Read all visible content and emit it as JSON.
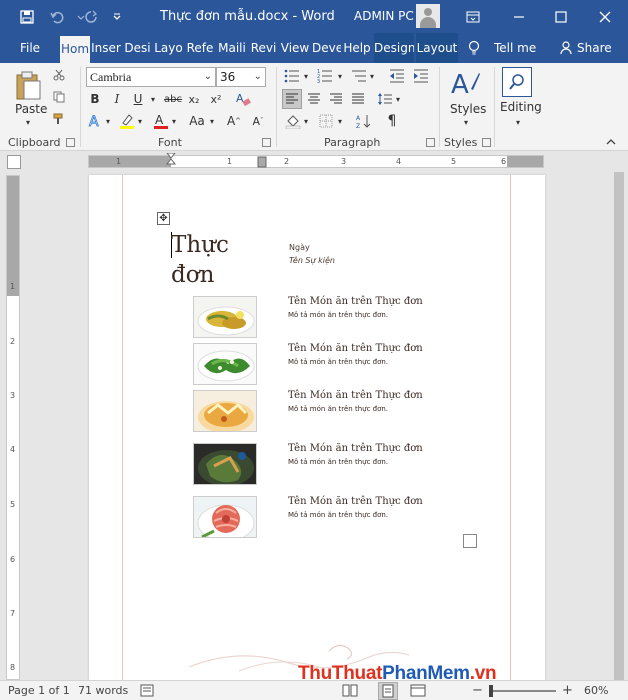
{
  "titlebar": {
    "document_title": "Thực đơn mẫu.docx  -  Word",
    "user_name": "ADMIN PC",
    "icons": [
      "save-icon",
      "undo-icon",
      "redo-icon",
      "customize-chevron-icon"
    ]
  },
  "tabs": [
    {
      "label": "File"
    },
    {
      "label": "Hom"
    },
    {
      "label": "Inser"
    },
    {
      "label": "Desi"
    },
    {
      "label": "Layo"
    },
    {
      "label": "Refe"
    },
    {
      "label": "Maili"
    },
    {
      "label": "Revi"
    },
    {
      "label": "View"
    },
    {
      "label": "Deve"
    },
    {
      "label": "Help"
    },
    {
      "label": "Design"
    },
    {
      "label": "Layout"
    }
  ],
  "tell_me": "Tell me",
  "share": "Share",
  "ribbon": {
    "clipboard": {
      "label": "Clipboard",
      "paste": "Paste"
    },
    "font": {
      "label": "Font",
      "name": "Cambria",
      "size": "36"
    },
    "paragraph": {
      "label": "Paragraph"
    },
    "styles": {
      "label": "Styles",
      "button": "Styles"
    },
    "editing": {
      "button": "Editing"
    }
  },
  "ruler": {
    "h_numbers": [
      "1",
      "1",
      "2",
      "3",
      "4",
      "5",
      "6"
    ],
    "v_numbers": [
      "1",
      "2",
      "3",
      "4",
      "5",
      "6",
      "7",
      "8"
    ]
  },
  "document": {
    "title_line1": "Thực",
    "title_line2": "đơn",
    "date": "Ngày",
    "event": "Tên Sự kiện",
    "dishes": [
      {
        "name": "Tên Món ăn trên Thực đơn",
        "desc": "Mô tả món ăn trên thực đơn."
      },
      {
        "name": "Tên Món ăn trên Thực đơn",
        "desc": "Mô tả món ăn trên thực đơn."
      },
      {
        "name": "Tên Món ăn trên Thực đơn",
        "desc": "Mô tả món ăn trên thực đơn."
      },
      {
        "name": "Tên Món ăn trên Thực đơn",
        "desc": "Mô tả món ăn trên thực đơn."
      },
      {
        "name": "Tên Món ăn trên Thực đơn",
        "desc": "Mô tả món ăn trên thực đơn."
      }
    ]
  },
  "status": {
    "page": "Page 1 of 1",
    "words": "71 words",
    "zoom": "60%",
    "zoom_minus": "−",
    "zoom_plus": "+"
  },
  "watermark": {
    "part1": "ThuThuat",
    "part2": "PhanMem",
    "part3": ".vn"
  },
  "colors": {
    "word_blue": "#2b579a",
    "ribbon_bg": "#f3f3f3"
  }
}
